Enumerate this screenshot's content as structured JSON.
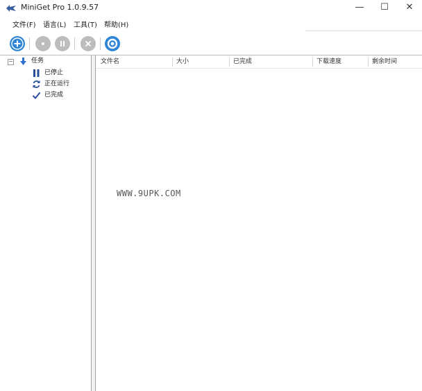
{
  "window": {
    "title": "MiniGet Pro 1.0.9.57",
    "minimize": "—",
    "maximize": "☐",
    "close": "✕"
  },
  "menu": [
    {
      "label": "文件(F)"
    },
    {
      "label": "语言(L)"
    },
    {
      "label": "工具(T)"
    },
    {
      "label": "帮助(H)"
    }
  ],
  "toolbar": {
    "colors": {
      "active_blue": "#2f86d6",
      "disabled_gray": "#bdbdbd"
    },
    "buttons": [
      "add-task",
      "start",
      "pause",
      "delete",
      "settings"
    ]
  },
  "tree": {
    "root": "任务",
    "children": [
      {
        "label": "已停止",
        "icon": "pause-icon"
      },
      {
        "label": "正在运行",
        "icon": "refresh-icon"
      },
      {
        "label": "已完成",
        "icon": "check-icon"
      }
    ]
  },
  "columns": [
    "文件名",
    "大小",
    "已完成",
    "下载速度",
    "剩余时间"
  ],
  "watermark": "WWW.9UPK.COM"
}
